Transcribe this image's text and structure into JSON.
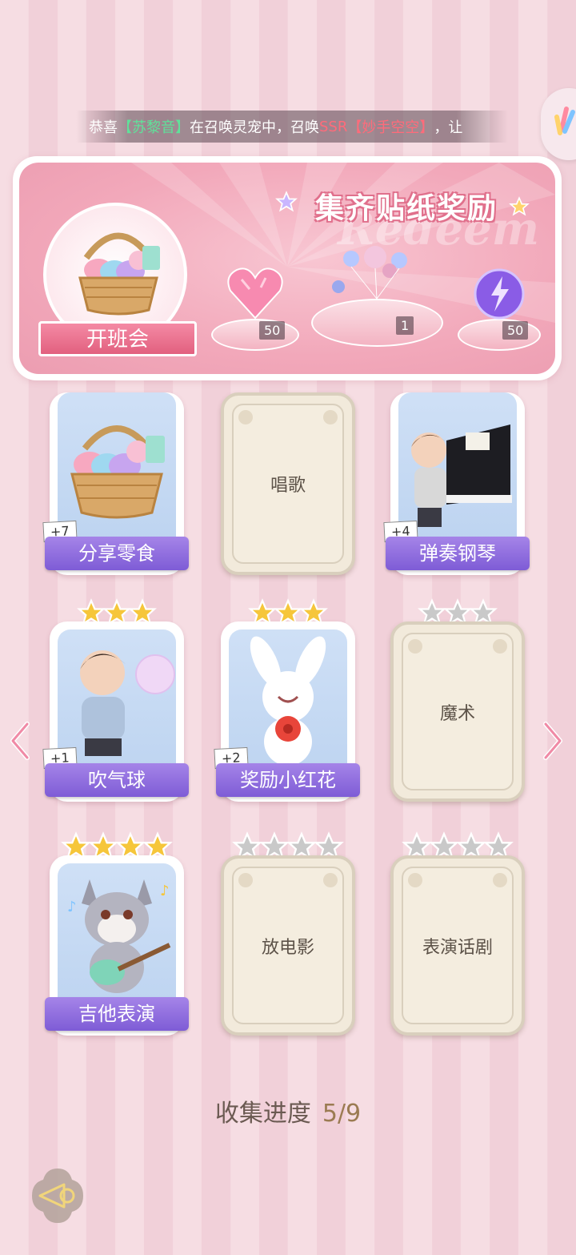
{
  "marquee": {
    "prefix": "恭喜",
    "player": "【苏黎音】",
    "middle": "在召唤灵宠中，召唤",
    "rarity": "SSR",
    "pet": "【妙手空空】",
    "suffix": "，让"
  },
  "panel": {
    "title": "集齐贴纸奖励",
    "watermark": "Redeem",
    "event_label": "开班会",
    "rewards": [
      {
        "name": "pink-heart-gem",
        "count": "50"
      },
      {
        "name": "balloon-decoration",
        "count": "1"
      },
      {
        "name": "purple-energy-orb",
        "count": "50"
      }
    ]
  },
  "cards": [
    {
      "name": "分享零食",
      "collected": true,
      "bonus": "+7",
      "stars": 0,
      "stars_filled": 0,
      "icon": "snack-basket"
    },
    {
      "name": "唱歌",
      "collected": false,
      "stars": 0,
      "stars_filled": 0
    },
    {
      "name": "弹奏钢琴",
      "collected": true,
      "bonus": "+4",
      "stars": 0,
      "stars_filled": 0,
      "icon": "boy-piano"
    },
    {
      "name": "吹气球",
      "collected": true,
      "bonus": "+1",
      "stars": 3,
      "stars_filled": 3,
      "icon": "boy-balloon"
    },
    {
      "name": "奖励小红花",
      "collected": true,
      "bonus": "+2",
      "stars": 3,
      "stars_filled": 3,
      "icon": "bunny-flower"
    },
    {
      "name": "魔术",
      "collected": false,
      "stars": 3,
      "stars_filled": 0
    },
    {
      "name": "吉他表演",
      "collected": true,
      "stars": 4,
      "stars_filled": 4,
      "icon": "wolf-guitar"
    },
    {
      "name": "放电影",
      "collected": false,
      "stars": 4,
      "stars_filled": 0
    },
    {
      "name": "表演话剧",
      "collected": false,
      "stars": 4,
      "stars_filled": 0
    }
  ],
  "progress": {
    "label": "收集进度",
    "value": "5/9"
  },
  "colors": {
    "ribbon": "#7e5cd6",
    "star_gold": "#f6c63a",
    "star_grey": "#c9c9c9",
    "title_pink": "#e0708c"
  }
}
